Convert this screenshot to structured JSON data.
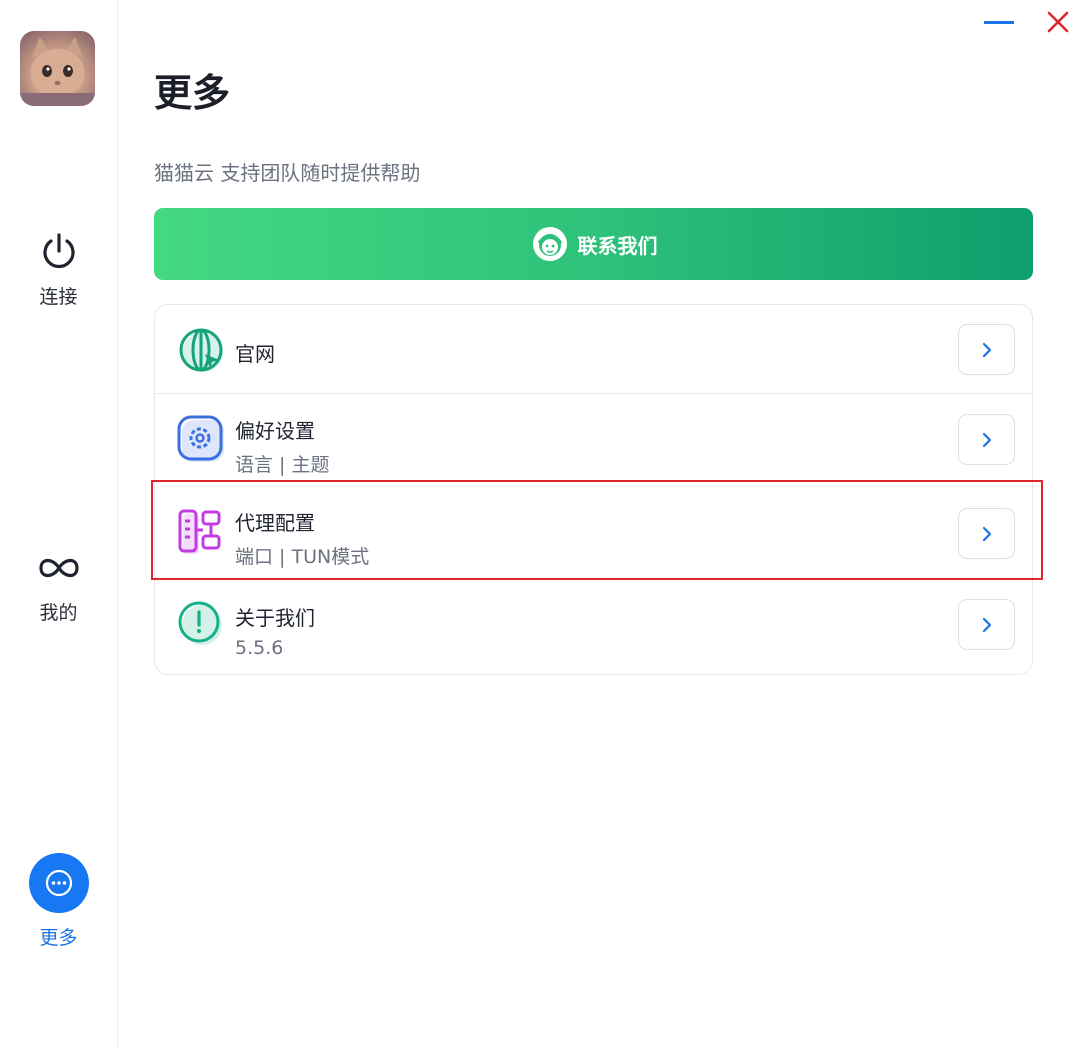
{
  "sidebar": {
    "items": [
      {
        "label": "连接",
        "icon": "power-icon"
      },
      {
        "label": "我的",
        "icon": "infinity-icon"
      },
      {
        "label": "更多",
        "icon": "more-dots-icon",
        "active": true
      }
    ]
  },
  "main": {
    "title": "更多",
    "subtitle": "猫猫云 支持团队随时提供帮助",
    "contact_button": "联系我们",
    "rows": [
      {
        "title": "官网",
        "subtitle": "",
        "icon": "globe-cursor-icon"
      },
      {
        "title": "偏好设置",
        "subtitle": "语言 | 主题",
        "icon": "settings-gear-icon"
      },
      {
        "title": "代理配置",
        "subtitle": "端口 | TUN模式",
        "icon": "proxy-config-icon"
      },
      {
        "title": "关于我们",
        "subtitle": "5.5.6",
        "icon": "info-exclamation-icon"
      }
    ]
  },
  "colors": {
    "accent": "#1877f2",
    "contact_gradient_start": "#45d882",
    "contact_gradient_end": "#0f9d6d",
    "highlight": "#e0262a",
    "close": "#e0262a"
  }
}
